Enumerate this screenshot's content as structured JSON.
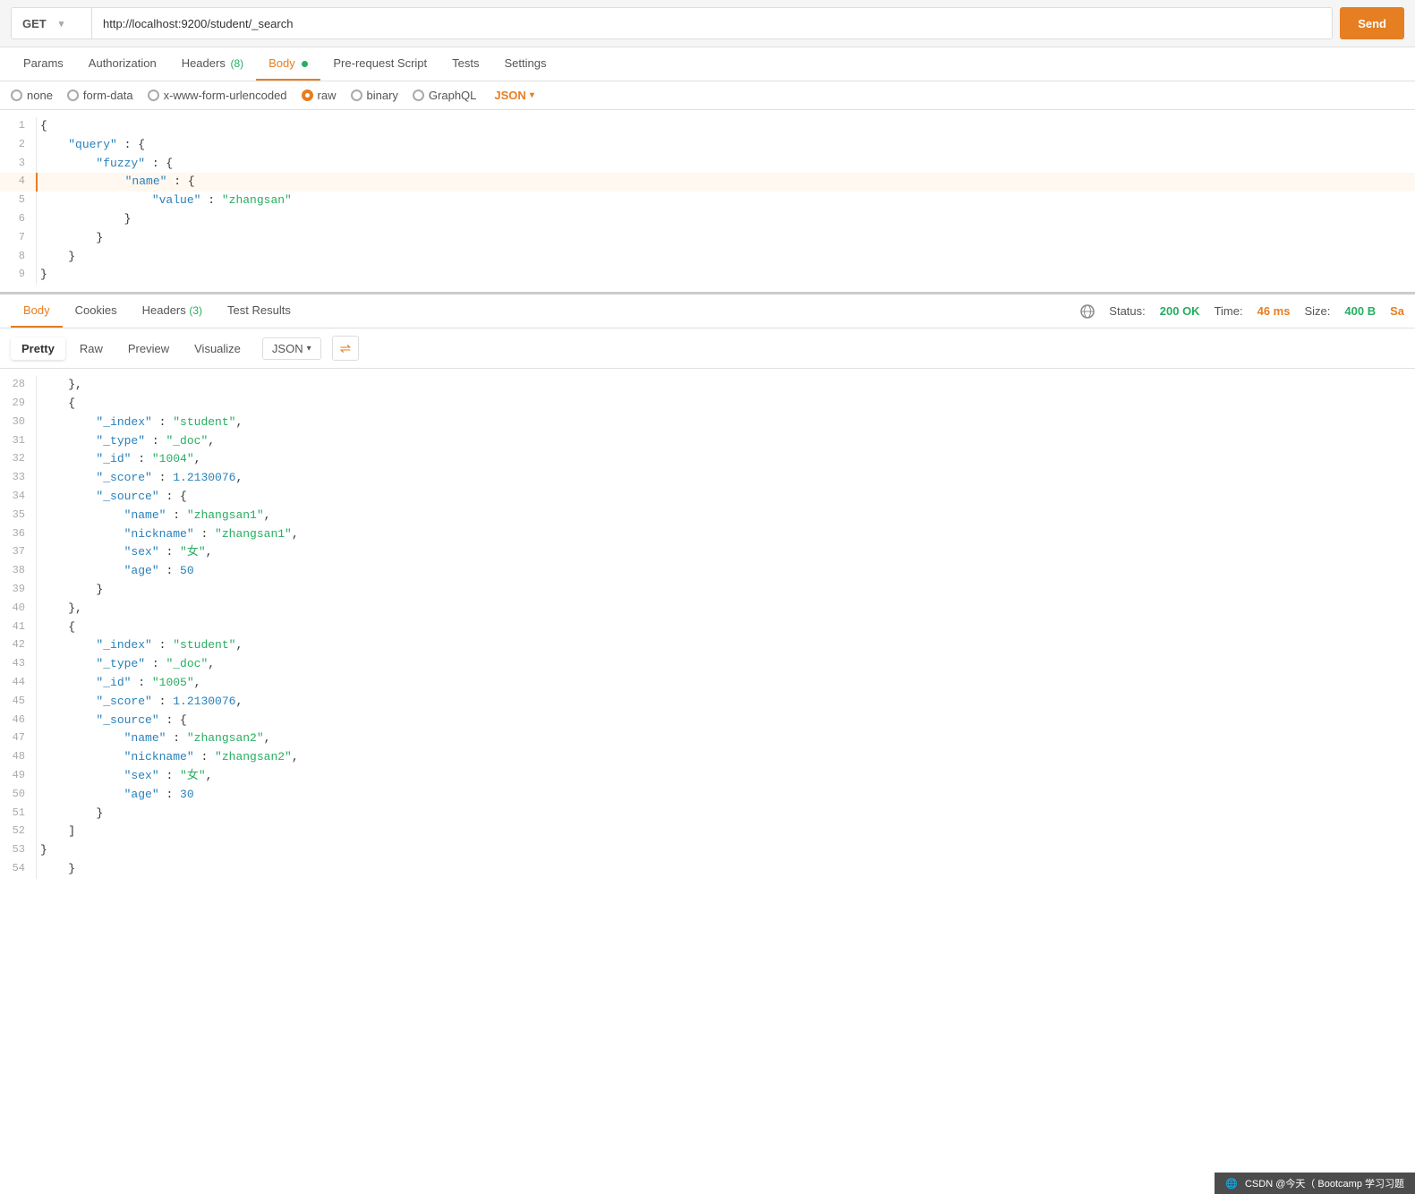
{
  "urlBar": {
    "method": "GET",
    "url": "http://localhost:9200/student/_search",
    "methodArrow": "▾"
  },
  "reqTabs": [
    {
      "label": "Params",
      "active": false,
      "badge": ""
    },
    {
      "label": "Authorization",
      "active": false,
      "badge": ""
    },
    {
      "label": "Headers",
      "active": false,
      "badge": "(8)"
    },
    {
      "label": "Body",
      "active": true,
      "badge": ""
    },
    {
      "label": "Pre-request Script",
      "active": false,
      "badge": ""
    },
    {
      "label": "Tests",
      "active": false,
      "badge": ""
    },
    {
      "label": "Settings",
      "active": false,
      "badge": ""
    }
  ],
  "bodyOptions": [
    {
      "label": "none",
      "selected": false
    },
    {
      "label": "form-data",
      "selected": false
    },
    {
      "label": "x-www-form-urlencoded",
      "selected": false
    },
    {
      "label": "raw",
      "selected": true
    },
    {
      "label": "binary",
      "selected": false
    },
    {
      "label": "GraphQL",
      "selected": false
    }
  ],
  "jsonLabel": "JSON",
  "requestCode": [
    {
      "num": 1,
      "content": "{",
      "highlighted": false
    },
    {
      "num": 2,
      "content": "    \"query\": {",
      "highlighted": false
    },
    {
      "num": 3,
      "content": "        \"fuzzy\": {",
      "highlighted": false
    },
    {
      "num": 4,
      "content": "            \"name\": {",
      "highlighted": true
    },
    {
      "num": 5,
      "content": "                \"value\": \"zhangsan\"",
      "highlighted": false
    },
    {
      "num": 6,
      "content": "            }",
      "highlighted": false
    },
    {
      "num": 7,
      "content": "        }",
      "highlighted": false
    },
    {
      "num": 8,
      "content": "    }",
      "highlighted": false
    },
    {
      "num": 9,
      "content": "}",
      "highlighted": false
    }
  ],
  "responseTabs": [
    {
      "label": "Body",
      "active": true,
      "badge": ""
    },
    {
      "label": "Cookies",
      "active": false,
      "badge": ""
    },
    {
      "label": "Headers",
      "active": false,
      "badge": "(3)"
    },
    {
      "label": "Test Results",
      "active": false,
      "badge": ""
    }
  ],
  "responseStatus": {
    "statusLabel": "Status:",
    "statusValue": "200 OK",
    "timeLabel": "Time:",
    "timeValue": "46 ms",
    "sizeLabel": "Size:",
    "sizeValue": "400 B",
    "extra": "Sa"
  },
  "formatTabs": [
    {
      "label": "Pretty",
      "active": true
    },
    {
      "label": "Raw",
      "active": false
    },
    {
      "label": "Preview",
      "active": false
    },
    {
      "label": "Visualize",
      "active": false
    }
  ],
  "formatSelect": "JSON",
  "responseLines": [
    {
      "num": 28,
      "content": "    },",
      "type": "normal"
    },
    {
      "num": 29,
      "content": "    {",
      "type": "normal"
    },
    {
      "num": 30,
      "content": "        \"_index\": \"student\",",
      "type": "index"
    },
    {
      "num": 31,
      "content": "        \"_type\": \"_doc\",",
      "type": "type"
    },
    {
      "num": 32,
      "content": "        \"_id\": \"1004\",",
      "type": "id"
    },
    {
      "num": 33,
      "content": "        \"_score\": 1.2130076,",
      "type": "score"
    },
    {
      "num": 34,
      "content": "        \"_source\": {",
      "type": "source"
    },
    {
      "num": 35,
      "content": "            \"name\": \"zhangsan1\",",
      "type": "field"
    },
    {
      "num": 36,
      "content": "            \"nickname\": \"zhangsan1\",",
      "type": "field"
    },
    {
      "num": 37,
      "content": "            \"sex\": \"女\",",
      "type": "field"
    },
    {
      "num": 38,
      "content": "            \"age\": 50",
      "type": "fieldnum"
    },
    {
      "num": 39,
      "content": "        }",
      "type": "normal"
    },
    {
      "num": 40,
      "content": "    },",
      "type": "normal"
    },
    {
      "num": 41,
      "content": "    {",
      "type": "normal"
    },
    {
      "num": 42,
      "content": "        \"_index\": \"student\",",
      "type": "index"
    },
    {
      "num": 43,
      "content": "        \"_type\": \"_doc\",",
      "type": "type"
    },
    {
      "num": 44,
      "content": "        \"_id\": \"1005\",",
      "type": "id"
    },
    {
      "num": 45,
      "content": "        \"_score\": 1.2130076,",
      "type": "score"
    },
    {
      "num": 46,
      "content": "        \"_source\": {",
      "type": "source"
    },
    {
      "num": 47,
      "content": "            \"name\": \"zhangsan2\",",
      "type": "field"
    },
    {
      "num": 48,
      "content": "            \"nickname\": \"zhangsan2\",",
      "type": "field"
    },
    {
      "num": 49,
      "content": "            \"sex\": \"女\",",
      "type": "field"
    },
    {
      "num": 50,
      "content": "            \"age\": 30",
      "type": "fieldnum"
    },
    {
      "num": 51,
      "content": "        }",
      "type": "normal"
    },
    {
      "num": 52,
      "content": "    ]",
      "type": "normal"
    },
    {
      "num": 53,
      "content": "}",
      "type": "normal"
    },
    {
      "num": 54,
      "content": "    }",
      "type": "normal"
    }
  ],
  "footer": {
    "text": "CSDN @今天（ Bootcamp 学习习题",
    "icon": "🌐"
  }
}
